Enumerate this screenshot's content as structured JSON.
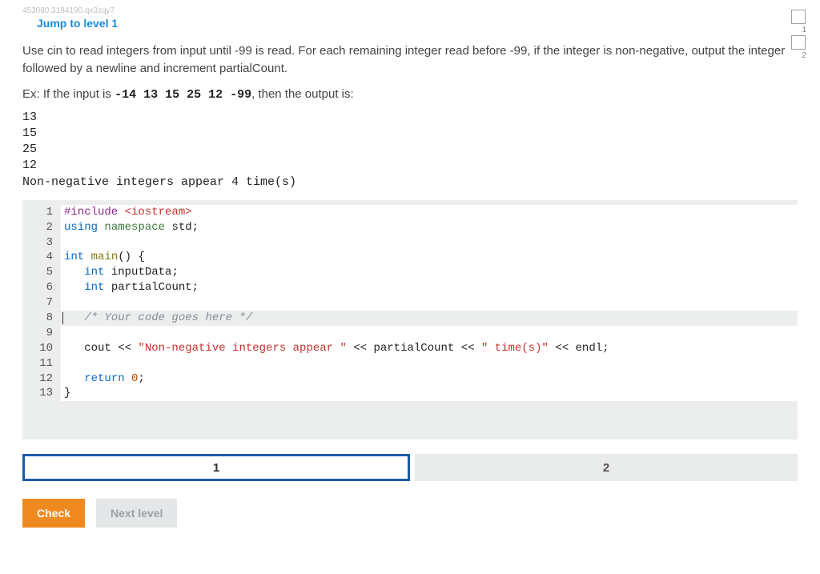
{
  "meta": {
    "small_id": "453080.3184190.qx3zqy7"
  },
  "header": {
    "jump_link": "Jump to level 1"
  },
  "problem": {
    "text": "Use cin to read integers from input until -99 is read. For each remaining integer read before -99, if the integer is non-negative, output the integer followed by a newline and increment partialCount.",
    "ex_prefix": "Ex: If the input is ",
    "ex_input": "-14 13 15 25 12 -99",
    "ex_suffix": ", then the output is:",
    "output_lines": [
      "13",
      "15",
      "25",
      "12",
      "Non-negative integers appear 4 time(s)"
    ]
  },
  "code": {
    "lines": [
      {
        "n": "1",
        "html": "<span class='tok-pp'>#include</span> <span class='tok-str'>&lt;iostream&gt;</span>"
      },
      {
        "n": "2",
        "html": "<span class='tok-kw'>using</span> <span class='tok-ns'>namespace</span> std;"
      },
      {
        "n": "3",
        "html": ""
      },
      {
        "n": "4",
        "html": "<span class='tok-ty'>int</span> <span class='tok-fn'>main</span>() {"
      },
      {
        "n": "5",
        "html": "   <span class='tok-ty'>int</span> inputData;"
      },
      {
        "n": "6",
        "html": "   <span class='tok-ty'>int</span> partialCount;"
      },
      {
        "n": "7",
        "html": ""
      },
      {
        "n": "8",
        "html": "   <span class='tok-cm'>/* Your code goes here */</span>",
        "active": true
      },
      {
        "n": "9",
        "html": ""
      },
      {
        "n": "10",
        "html": "   cout &lt;&lt; <span class='tok-str'>\"Non-negative integers appear \"</span> &lt;&lt; partialCount &lt;&lt; <span class='tok-str'>\" time(s)\"</span> &lt;&lt; endl;"
      },
      {
        "n": "11",
        "html": ""
      },
      {
        "n": "12",
        "html": "   <span class='tok-kw'>return</span> <span class='tok-num'>0</span>;"
      },
      {
        "n": "13",
        "html": "}"
      }
    ]
  },
  "steps": [
    {
      "label": "1",
      "active": true
    },
    {
      "label": "2",
      "active": false
    }
  ],
  "buttons": {
    "check": "Check",
    "next": "Next level"
  },
  "sidebar": {
    "boxes": [
      {
        "label": "1"
      },
      {
        "label": "2"
      }
    ]
  }
}
